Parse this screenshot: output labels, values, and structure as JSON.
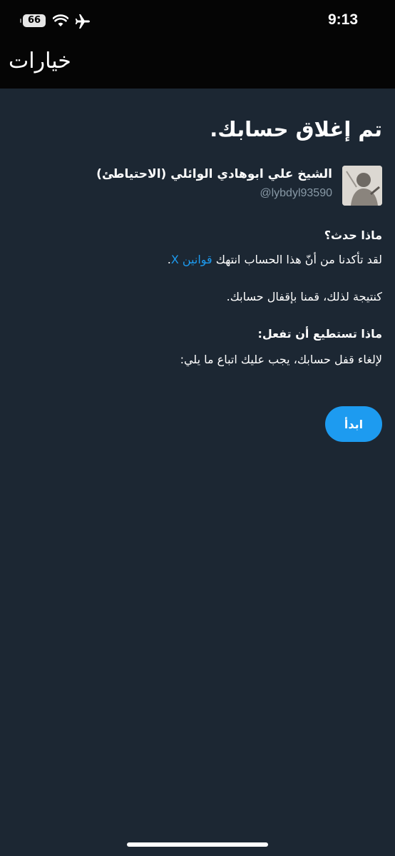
{
  "status_bar": {
    "battery": "66",
    "time": "9:13",
    "icons": [
      "battery-icon",
      "wifi-icon",
      "airplane-icon"
    ]
  },
  "nav": {
    "title": "خيارات"
  },
  "main": {
    "headline": "تم إغلاق حسابك.",
    "account": {
      "display_name": "الشيخ علي ابوهادي الوائلي (الاحتياطئ)",
      "handle": "@lybdyl93590"
    },
    "what_happened": {
      "title": "ماذا حدث؟",
      "text_before_link": "لقد تأكدنا من أنّ هذا الحساب انتهك ",
      "link": "قوانين X",
      "text_after_link": ".",
      "consequence": "كنتيجة لذلك، قمنا بإقفال حسابك."
    },
    "what_you_can_do": {
      "title": "ماذا تستطيع أن تفعل:",
      "text": "لإلغاء قفل حسابك، يجب عليك اتباع ما يلي:"
    },
    "start_button": "ابدأ"
  },
  "colors": {
    "background": "#1c2733",
    "bar": "#050505",
    "accent": "#1d9bf0",
    "muted": "#8899a6"
  }
}
